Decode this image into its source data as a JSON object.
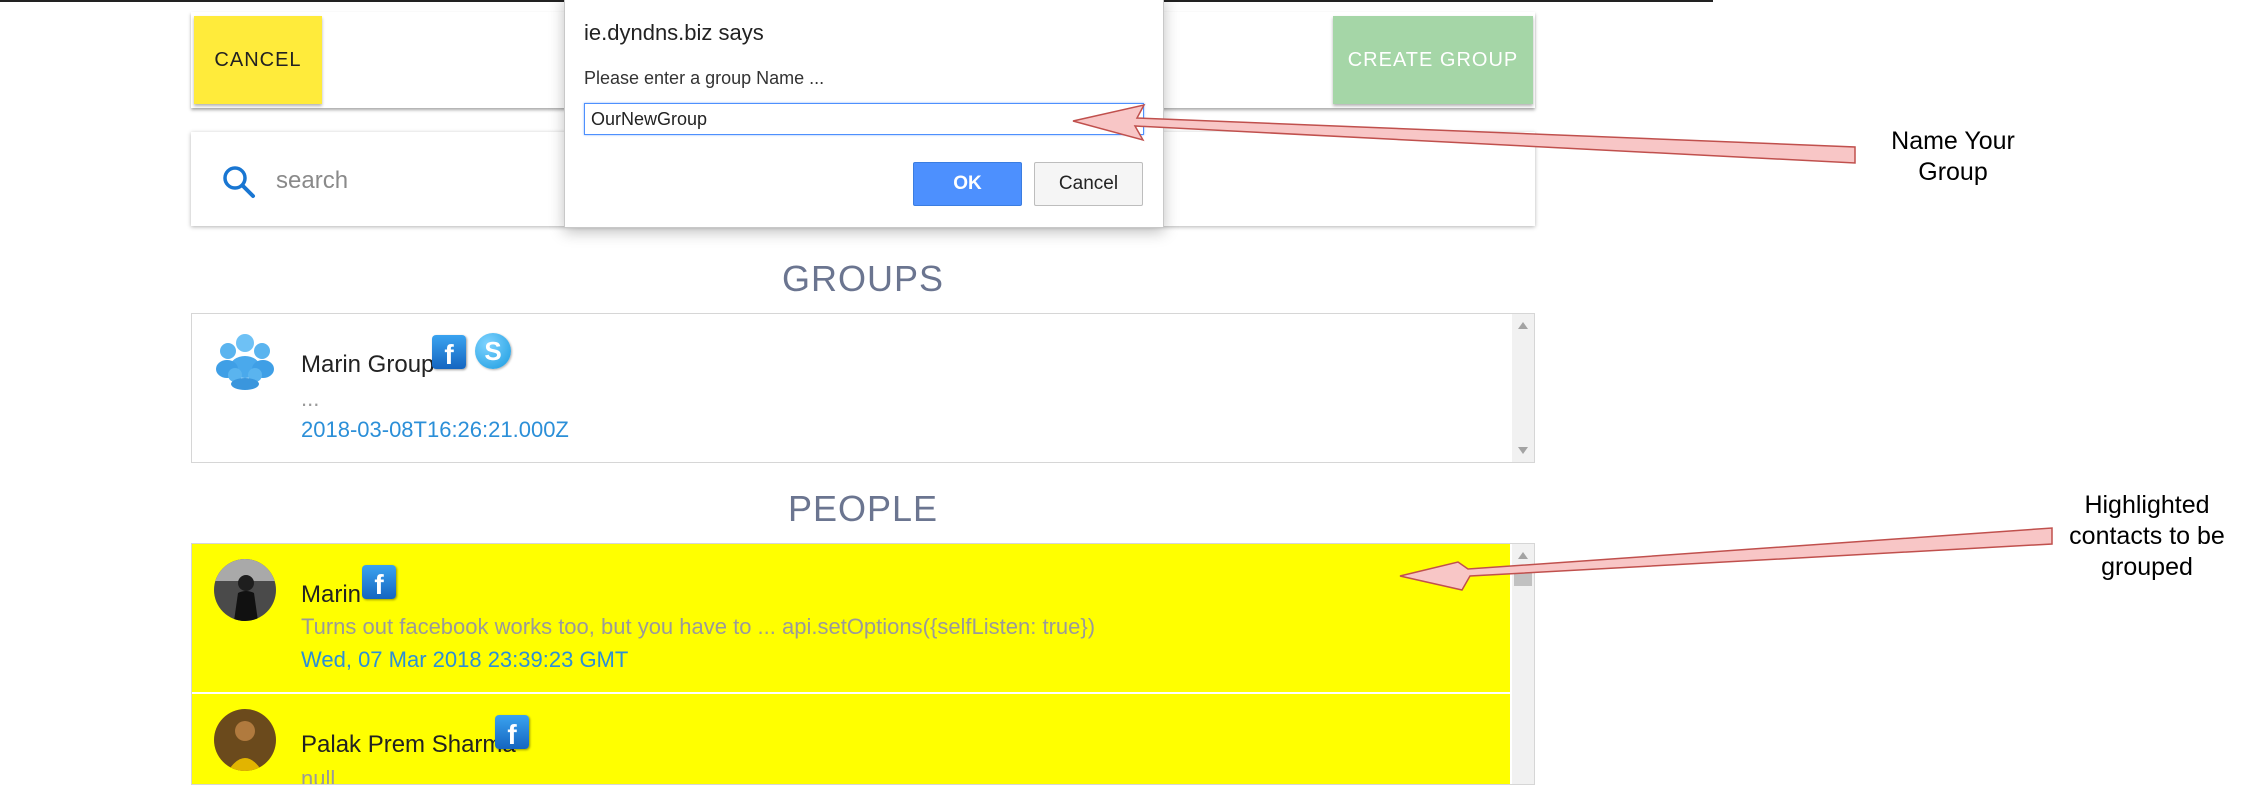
{
  "toolbar": {
    "cancel_label": "CANCEL",
    "create_group_label": "CREATE GROUP"
  },
  "search": {
    "placeholder": "search",
    "value": ""
  },
  "groups": {
    "heading": "GROUPS",
    "items": [
      {
        "name": "Marin Group",
        "subtitle": "...",
        "timestamp": "2018-03-08T16:26:21.000Z",
        "icons": [
          "group-icon",
          "facebook-icon",
          "skype-icon"
        ]
      }
    ]
  },
  "people": {
    "heading": "PEOPLE",
    "highlight_color": "#ffff00",
    "items": [
      {
        "name": "Marin",
        "subtitle": "Turns out facebook works too, but you have to ... api.setOptions({selfListen: true})",
        "timestamp": "Wed, 07 Mar 2018 23:39:23 GMT",
        "highlighted": true,
        "icons": [
          "facebook-icon"
        ]
      },
      {
        "name": "Palak Prem Sharma",
        "subtitle": "null",
        "highlighted": true,
        "icons": [
          "facebook-icon"
        ]
      }
    ]
  },
  "dialog": {
    "title": "ie.dyndns.biz says",
    "message": "Please enter a group Name ...",
    "input_value": "OurNewGroup",
    "ok_label": "OK",
    "cancel_label": "Cancel"
  },
  "annotations": {
    "name_group_line1": "Name Your",
    "name_group_line2": "Group",
    "highlight_line1": "Highlighted",
    "highlight_line2": "contacts to be",
    "highlight_line3": "grouped"
  },
  "colors": {
    "cancel_button": "#ffeb3b",
    "create_button": "#a5d6a7",
    "link_blue": "#2b8fd8",
    "heading": "#6b7590",
    "ok_button": "#4d90fe",
    "arrow_fill": "#f8c6c6",
    "arrow_stroke": "#c0504d"
  }
}
